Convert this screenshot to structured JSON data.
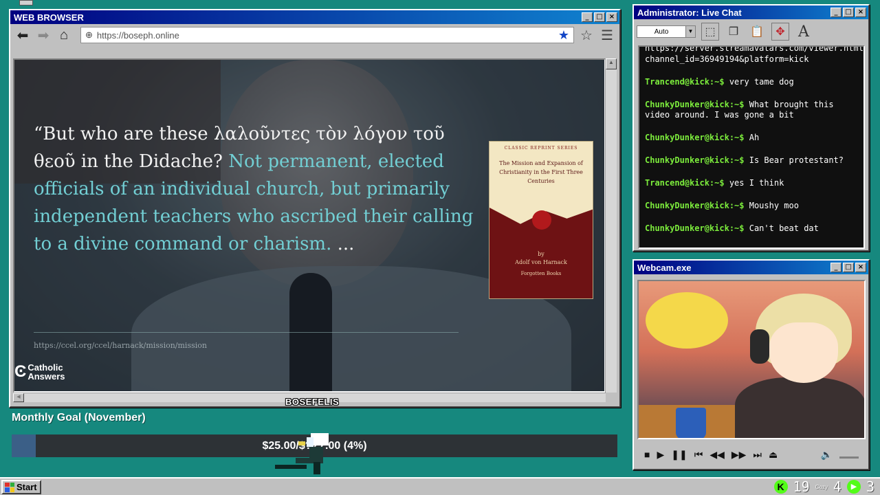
{
  "browser": {
    "title": "WEB BROWSER",
    "url": "https://boseph.online",
    "video": {
      "quote_white": "“But who are these λαλοῦντες τὸν λόγον τοῦ θεοῦ in the Didache?",
      "quote_teal": "Not permanent, elected officials of an individual church, but primarily independent teachers who ascribed their calling to a divine command or charism.",
      "quote_tail": "...",
      "source_url": "https://ccel.org/ccel/harnack/mission/mission",
      "logo_line1": "Catholic",
      "logo_line2": "Answers",
      "book": {
        "series": "CLASSIC REPRINT SERIES",
        "title": "The Mission and Expansion of Christianity in the First Three Centuries",
        "by": "by",
        "author": "Adolf von Harnack",
        "publisher": "Forgotten Books"
      }
    },
    "nameplate": "BOSEFELIS"
  },
  "goal": {
    "title": "Monthly Goal (November)",
    "text": "$25.00/$???.00 (4%)",
    "percent": 4
  },
  "chat": {
    "title": "Administrator: Live Chat",
    "font_select": "Auto",
    "header_text": "https://server.streamavatars.com/viewer.html?channel_id=36949194&platform=kick",
    "messages": [
      {
        "user": "Trancend@kick:~$",
        "text": "very tame dog"
      },
      {
        "user": "ChunkyDunker@kick:~$",
        "text": "What brought this video around. I was gone a bit"
      },
      {
        "user": "ChunkyDunker@kick:~$",
        "text": "Ah"
      },
      {
        "user": "ChunkyDunker@kick:~$",
        "text": "Is Bear protestant?"
      },
      {
        "user": "Trancend@kick:~$",
        "text": "yes I think"
      },
      {
        "user": "ChunkyDunker@kick:~$",
        "text": "Moushy moo"
      },
      {
        "user": "ChunkyDunker@kick:~$",
        "text": "Can't beat dat"
      }
    ]
  },
  "webcam": {
    "title": "Webcam.exe"
  },
  "taskbar": {
    "start": "Start",
    "kick_count": "19",
    "cozy_label": "Cozy",
    "cozy_count": "4",
    "play_count": "3"
  },
  "colors": {
    "desktop": "#16887e",
    "titlebar": "#000080",
    "chat_user": "#7cec3c",
    "kick_green": "#53fc18",
    "goal_fill": "#3b5f87"
  }
}
